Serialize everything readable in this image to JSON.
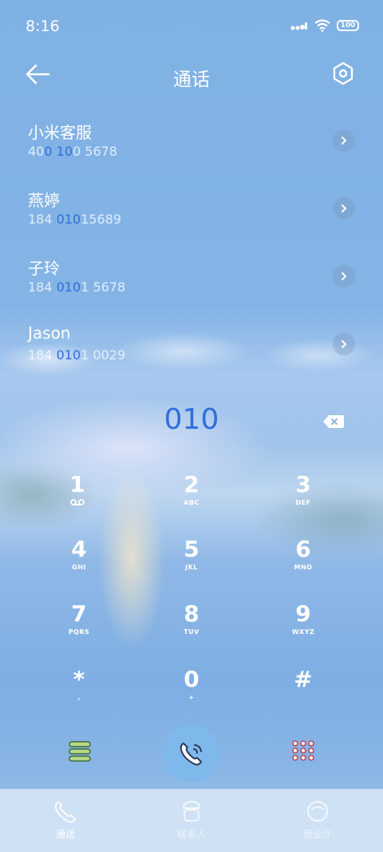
{
  "status": {
    "time": "8:16",
    "battery": "100"
  },
  "header": {
    "title": "通话"
  },
  "contacts": [
    {
      "name": "小米客服",
      "num_pre": "40",
      "num_hl1": "0",
      "num_mid": " ",
      "num_hl2": "10",
      "num_post": "0 5678"
    },
    {
      "name": "燕婷",
      "num_pre": "184 ",
      "num_hl1": "010",
      "num_mid": "",
      "num_hl2": "",
      "num_post": "15689"
    },
    {
      "name": "子玲",
      "num_pre": "184 ",
      "num_hl1": "010",
      "num_mid": "",
      "num_hl2": "",
      "num_post": "1 5678"
    },
    {
      "name": "Jason",
      "num_pre": "184 ",
      "num_hl1": "010",
      "num_mid": "",
      "num_hl2": "",
      "num_post": "1 0029"
    }
  ],
  "dialer": {
    "input": "010"
  },
  "keypad": [
    {
      "digit": "1",
      "sub": "voicemail"
    },
    {
      "digit": "2",
      "sub": "ABC"
    },
    {
      "digit": "3",
      "sub": "DEF"
    },
    {
      "digit": "4",
      "sub": "GHI"
    },
    {
      "digit": "5",
      "sub": "JKL"
    },
    {
      "digit": "6",
      "sub": "MNO"
    },
    {
      "digit": "7",
      "sub": "PQRS"
    },
    {
      "digit": "8",
      "sub": "TUV"
    },
    {
      "digit": "9",
      "sub": "WXYZ"
    },
    {
      "digit": "*",
      "sub": ","
    },
    {
      "digit": "0",
      "sub": "+"
    },
    {
      "digit": "#",
      "sub": ""
    }
  ],
  "nav": [
    {
      "label": "通话",
      "icon": "phone-icon",
      "active": true
    },
    {
      "label": "联系人",
      "icon": "contacts-icon",
      "active": false
    },
    {
      "label": "营业厅",
      "icon": "service-icon",
      "active": false
    }
  ],
  "colors": {
    "accent": "#2f6fd8",
    "background": "#80b1e4",
    "call_button": "#7fb8ea"
  }
}
